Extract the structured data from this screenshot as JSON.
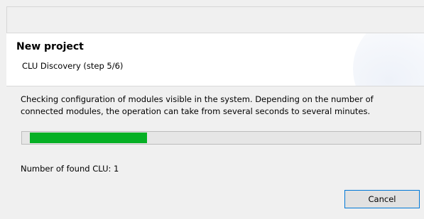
{
  "header": {
    "title": "New project",
    "subtitle": "CLU Discovery (step 5/6)"
  },
  "content": {
    "description": "Checking configuration of modules visible in the system. Depending on the number of connected modules, the operation can take from several seconds to several minutes.",
    "progress_fraction": 0.3,
    "progress_color": "#06b025",
    "found_text": "Number of found CLU: 1"
  },
  "buttons": {
    "cancel_label": "Cancel"
  }
}
